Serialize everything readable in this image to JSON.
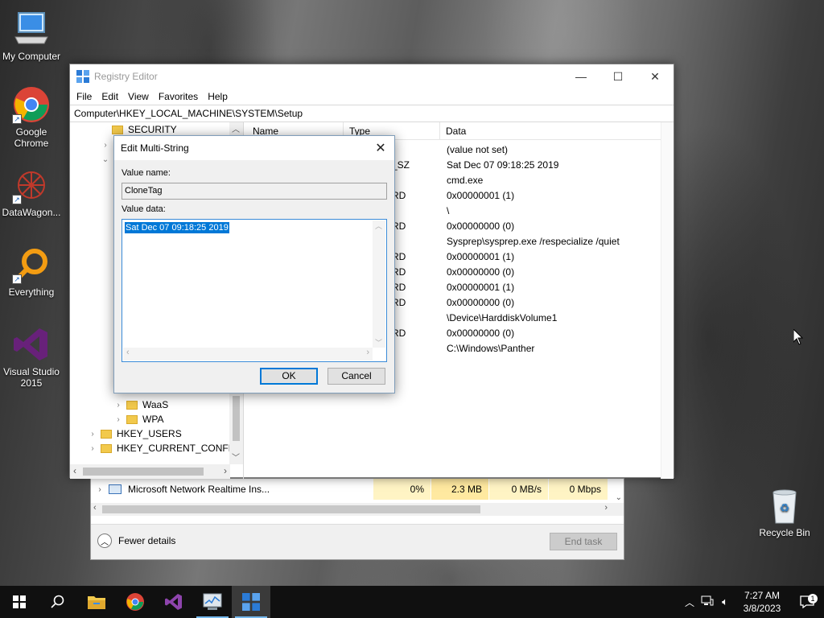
{
  "desktop": {
    "icons": [
      {
        "label": "My Computer"
      },
      {
        "label": "Google Chrome"
      },
      {
        "label": "DataWagon..."
      },
      {
        "label": "Everything"
      },
      {
        "label": "Visual Studio 2015"
      },
      {
        "label": "Recycle Bin"
      }
    ]
  },
  "regedit": {
    "title": "Registry Editor",
    "menu": [
      "File",
      "Edit",
      "View",
      "Favorites",
      "Help"
    ],
    "address": "Computer\\HKEY_LOCAL_MACHINE\\SYSTEM\\Setup",
    "tree": [
      {
        "label": "SECURITY"
      },
      {
        "label": "WaaS"
      },
      {
        "label": "WPA"
      },
      {
        "label": "HKEY_USERS"
      },
      {
        "label": "HKEY_CURRENT_CONFIG"
      }
    ],
    "columns": {
      "name": "Name",
      "type": "Type",
      "data": "Data"
    },
    "rows": [
      {
        "type": "",
        "data": "(value not set)"
      },
      {
        "type": "_SZ",
        "data": "Sat Dec 07 09:18:25 2019"
      },
      {
        "type": "",
        "data": "cmd.exe"
      },
      {
        "type": "RD",
        "data": "0x00000001 (1)"
      },
      {
        "type": "",
        "data": "\\"
      },
      {
        "type": "RD",
        "data": "0x00000000 (0)"
      },
      {
        "type": "",
        "data": "Sysprep\\sysprep.exe /respecialize /quiet"
      },
      {
        "type": "RD",
        "data": "0x00000001 (1)"
      },
      {
        "type": "RD",
        "data": "0x00000000 (0)"
      },
      {
        "type": "RD",
        "data": "0x00000001 (1)"
      },
      {
        "type": "RD",
        "data": "0x00000000 (0)"
      },
      {
        "type": "",
        "data": "\\Device\\HarddiskVolume1"
      },
      {
        "type": "RD",
        "data": "0x00000000 (0)"
      },
      {
        "type": "",
        "data": "C:\\Windows\\Panther"
      }
    ]
  },
  "dialog": {
    "title": "Edit Multi-String",
    "value_name_label": "Value name:",
    "value_name": "CloneTag",
    "value_data_label": "Value data:",
    "value_data": "Sat Dec 07 09:18:25 2019",
    "ok": "OK",
    "cancel": "Cancel"
  },
  "taskmgr": {
    "process": "Microsoft Network Realtime Ins...",
    "cpu": "0%",
    "memory": "2.3 MB",
    "disk": "0 MB/s",
    "network": "0 Mbps",
    "fewer_details": "Fewer details",
    "end_task": "End task"
  },
  "taskbar": {
    "time": "7:27 AM",
    "date": "3/8/2023",
    "notifications": "1"
  }
}
